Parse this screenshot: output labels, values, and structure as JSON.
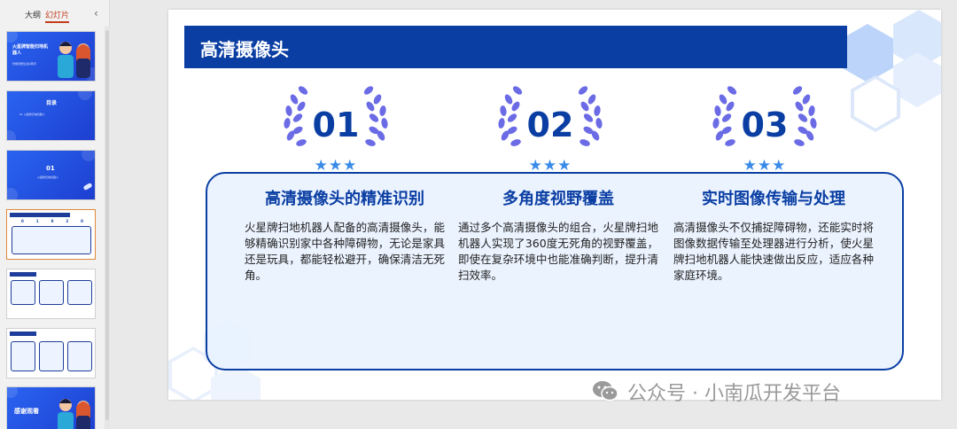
{
  "left_panel": {
    "tabs": [
      {
        "label": "大纲"
      },
      {
        "label": "幻灯片"
      }
    ],
    "thumbnails": [
      {
        "title": "火星牌智能扫地机器人",
        "subtitle": "智能家居生活好帮手"
      },
      {
        "title": "目录",
        "subtitle": "01 火星牌扫地机器人"
      },
      {
        "title": "01",
        "subtitle": "火星牌扫地机器人"
      },
      {
        "title": "",
        "subtitle": ""
      },
      {
        "title": "",
        "subtitle": ""
      },
      {
        "title": "",
        "subtitle": ""
      },
      {
        "title": "感谢观看",
        "subtitle": ""
      }
    ]
  },
  "slide": {
    "title": "高清摄像头",
    "columns": [
      {
        "number": "01",
        "heading": "高清摄像头的精准识别",
        "body": "火星牌扫地机器人配备的高清摄像头，能够精确识别家中各种障碍物，无论是家具还是玩具，都能轻松避开，确保清洁无死角。"
      },
      {
        "number": "02",
        "heading": "多角度视野覆盖",
        "body": "通过多个高清摄像头的组合，火星牌扫地机器人实现了360度无死角的视野覆盖，即使在复杂环境中也能准确判断，提升清扫效率。"
      },
      {
        "number": "03",
        "heading": "实时图像传输与处理",
        "body": "高清摄像头不仅捕捉障碍物，还能实时将图像数据传输至处理器进行分析，使火星牌扫地机器人能快速做出反应，适应各种家庭环境。"
      }
    ],
    "stars": "★★★"
  },
  "watermark": {
    "text": "公众号 · 小南瓜开发平台"
  },
  "colors": {
    "accent": "#0a3ea3",
    "laurel": "#6b6be6",
    "star": "#3a8be8",
    "tab_active": "#c43b1d",
    "selected_border": "#e0893a"
  }
}
